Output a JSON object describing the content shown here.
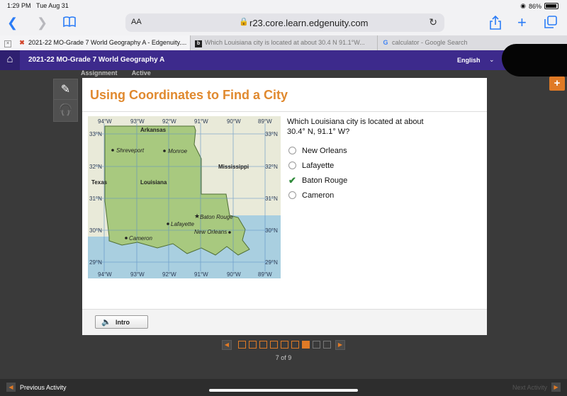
{
  "status": {
    "time": "1:29 PM",
    "date": "Tue Aug 31",
    "battery": "86%"
  },
  "browser": {
    "text_size": "AA",
    "url": "r23.core.learn.edgenuity.com"
  },
  "tabs": [
    {
      "icon": "x-icon",
      "label": "2021-22 MO-Grade 7 World Geography A - Edgenuity...."
    },
    {
      "icon": "logo-icon",
      "label": "Which Louisiana city is located at about 30.4 N 91.1°W..."
    },
    {
      "icon": "google-icon",
      "label": "calculator - Google Search"
    }
  ],
  "appbar": {
    "course": "2021-22 MO-Grade 7 World Geography A",
    "language": "English"
  },
  "behind": {
    "left": "Assignment",
    "right": "Active"
  },
  "card": {
    "title": "Using Coordinates to Find a City"
  },
  "map": {
    "top_labels": [
      "94°W",
      "93°W",
      "92°W",
      "91°W",
      "90°W",
      "89°W"
    ],
    "bottom_labels": [
      "94°W",
      "93°W",
      "92°W",
      "91°W",
      "90°W",
      "89°W"
    ],
    "left_labels": [
      "33°N",
      "32°N",
      "31°N",
      "30°N",
      "29°N"
    ],
    "right_labels": [
      "33°N",
      "32°N",
      "31°N",
      "30°N",
      "29°N"
    ],
    "regions": {
      "arkansas": "Arkansas",
      "louisiana": "Louisiana",
      "mississippi": "Mississippi",
      "texas": "Texas"
    },
    "cities": {
      "shreveport": "Shreveport",
      "monroe": "Monroe",
      "baton_rouge": "Baton Rouge",
      "lafayette": "Lafayette",
      "new_orleans": "New Orleans",
      "cameron": "Cameron"
    }
  },
  "question": {
    "text": "Which Louisiana city is located at about 30.4° N, 91.1° W?",
    "options": [
      "New Orleans",
      "Lafayette",
      "Baton Rouge",
      "Cameron"
    ],
    "checked_option": "Baton Rouge"
  },
  "footer": {
    "intro_label": "Intro"
  },
  "pager": {
    "current": 7,
    "total": 9,
    "label": "7 of 9"
  },
  "bottom": {
    "previous": "Previous Activity",
    "next": "Next Activity"
  },
  "colors": {
    "accent": "#e07a26",
    "header": "#3d2a8c",
    "land": "#a8c97f",
    "water": "#a9cfe0"
  }
}
